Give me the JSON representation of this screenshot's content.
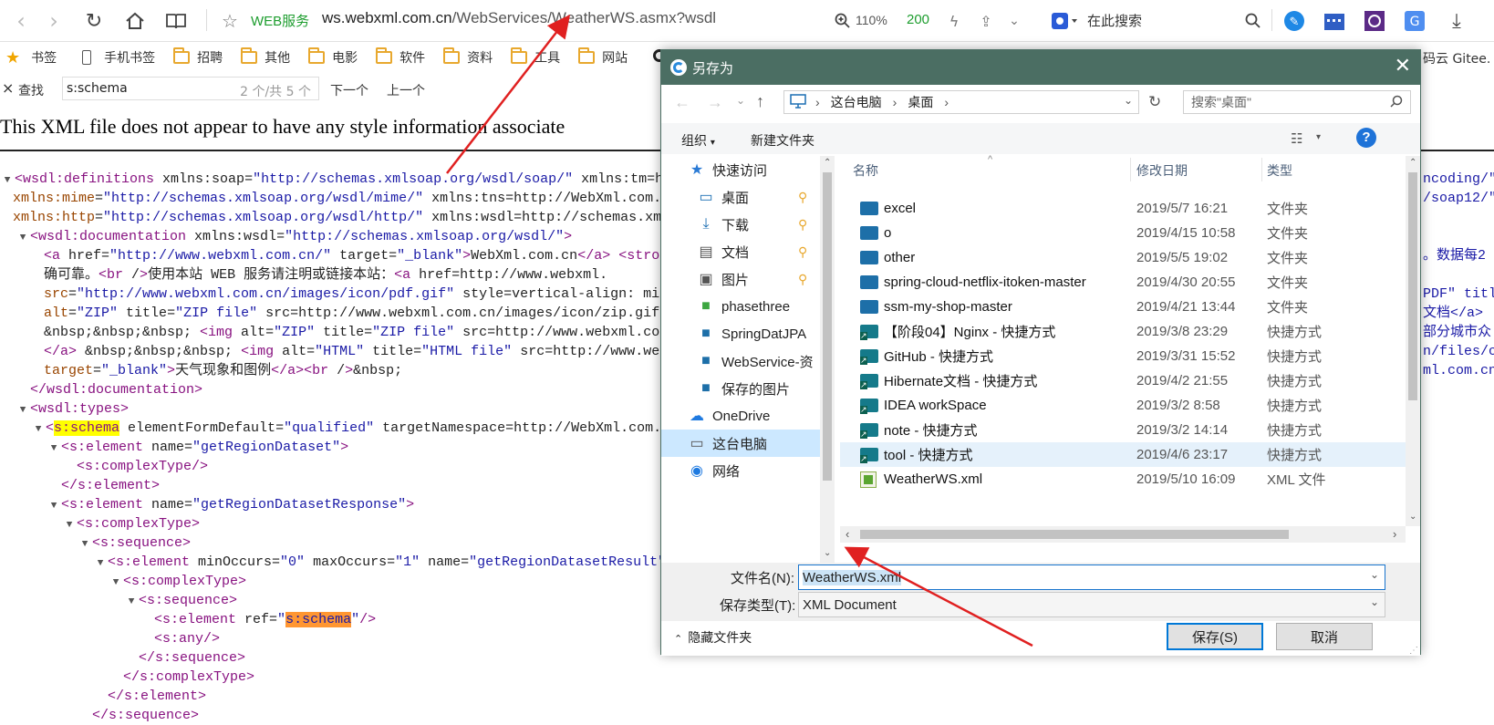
{
  "browser": {
    "service_label": "WEB服务",
    "url_host": "ws.webxml.com.cn",
    "url_path": "/WebServices/WeatherWS.asmx?wsdl",
    "zoom": "110%",
    "hits": "200",
    "search_placeholder": "在此搜索",
    "bookmarks": [
      "书签",
      "手机书签",
      "招聘",
      "其他",
      "电影",
      "软件",
      "资料",
      "工具",
      "网站"
    ],
    "bookmark_right": "码云 Gitee."
  },
  "findbar": {
    "label": "查找",
    "query": "s:schema",
    "count": "2 个/共 5 个",
    "next": "下一个",
    "prev": "上一个"
  },
  "xml_notice": "This XML file does not appear to have any style information associate",
  "xml_lines": [
    "<wsdl:definitions xmlns:soap=\"http://schemas.xmlsoap.org/wsdl/soap/\" xmlns:tm=\"h",
    "xmlns:mime=\"http://schemas.xmlsoap.org/wsdl/mime/\" xmlns:tns=\"http://WebXml.com.",
    "xmlns:http=\"http://schemas.xmlsoap.org/wsdl/http/\" xmlns:wsdl=\"http://schemas.xm",
    "<wsdl:documentation xmlns:wsdl=\"http://schemas.xmlsoap.org/wsdl/\">",
    "<a href=\"http://www.webxml.com.cn/\" target=\"_blank\">WebXml.com.cn</a> <stron",
    "确可靠。<br />使用本站 WEB 服务请注明或链接本站：<a href=\"http://www.webxml.",
    "src=\"http://www.webxml.com.cn/images/icon/pdf.gif\" style=\"vertical-align: mi",
    "alt=\"ZIP\" title=\"ZIP file\" src=\"http://www.webxml.com.cn/images/icon/zip.gif",
    "&nbsp;&nbsp;&nbsp; <img alt=\"ZIP\" title=\"ZIP file\" src=\"http://www.webxml.co",
    "</a> &nbsp;&nbsp;&nbsp; <img alt=\"HTML\" title=\"HTML file\" src=\"http://www.we",
    "target=\"_blank\">天气现象和图例</a><br />&nbsp;",
    "</wsdl:documentation>",
    "<wsdl:types>",
    "<s:schema elementFormDefault=\"qualified\" targetNamespace=\"http://WebXml.com.",
    "<s:element name=\"getRegionDataset\">",
    "<s:complexType/>",
    "</s:element>",
    "<s:element name=\"getRegionDatasetResponse\">",
    "<s:complexType>",
    "<s:sequence>",
    "<s:element minOccurs=\"0\" maxOccurs=\"1\" name=\"getRegionDatasetResult\"",
    "<s:complexType>",
    "<s:sequence>",
    "<s:element ref=\"s:schema\"/>",
    "<s:any/>",
    "</s:sequence>",
    "</s:complexType>",
    "</s:element>",
    "</s:sequence>"
  ],
  "xml_right_fragments": [
    "ncoding/\"",
    "/soap12/\"",
    "。数据每2",
    "PDF\" titl",
    "文档</a>",
    "部分城市众",
    "n/files/c",
    "ml.com.cn"
  ],
  "dialog": {
    "title": "另存为",
    "breadcrumb": [
      "这台电脑",
      "桌面"
    ],
    "search_placeholder": "搜索\"桌面\"",
    "organize": "组织",
    "new_folder": "新建文件夹",
    "nav": [
      {
        "label": "快速访问",
        "icon": "star-icon"
      },
      {
        "label": "桌面",
        "icon": "desktop-icon"
      },
      {
        "label": "下载",
        "icon": "download-icon"
      },
      {
        "label": "文档",
        "icon": "document-icon"
      },
      {
        "label": "图片",
        "icon": "picture-icon"
      },
      {
        "label": "phasethree",
        "icon": "folder-green-icon"
      },
      {
        "label": "SpringDatJPA",
        "icon": "folder-icon"
      },
      {
        "label": "WebService-资",
        "icon": "folder-icon"
      },
      {
        "label": "保存的图片",
        "icon": "folder-icon"
      },
      {
        "label": "OneDrive",
        "icon": "cloud-icon"
      },
      {
        "label": "这台电脑",
        "icon": "computer-icon"
      },
      {
        "label": "网络",
        "icon": "network-icon"
      }
    ],
    "columns": [
      "名称",
      "修改日期",
      "类型"
    ],
    "files": [
      {
        "name": "excel",
        "date": "2019/5/7 16:21",
        "type": "文件夹",
        "kind": "folder"
      },
      {
        "name": "o",
        "date": "2019/4/15 10:58",
        "type": "文件夹",
        "kind": "folder"
      },
      {
        "name": "other",
        "date": "2019/5/5 19:02",
        "type": "文件夹",
        "kind": "folder"
      },
      {
        "name": "spring-cloud-netflix-itoken-master",
        "date": "2019/4/30 20:55",
        "type": "文件夹",
        "kind": "folder"
      },
      {
        "name": "ssm-my-shop-master",
        "date": "2019/4/21 13:44",
        "type": "文件夹",
        "kind": "folder"
      },
      {
        "name": "【阶段04】Nginx - 快捷方式",
        "date": "2019/3/8 23:29",
        "type": "快捷方式",
        "kind": "shortcut"
      },
      {
        "name": "GitHub - 快捷方式",
        "date": "2019/3/31 15:52",
        "type": "快捷方式",
        "kind": "shortcut"
      },
      {
        "name": "Hibernate文档 - 快捷方式",
        "date": "2019/4/2 21:55",
        "type": "快捷方式",
        "kind": "shortcut"
      },
      {
        "name": "IDEA workSpace",
        "date": "2019/3/2 8:58",
        "type": "快捷方式",
        "kind": "shortcut"
      },
      {
        "name": "note - 快捷方式",
        "date": "2019/3/2 14:14",
        "type": "快捷方式",
        "kind": "shortcut"
      },
      {
        "name": "tool - 快捷方式",
        "date": "2019/4/6 23:17",
        "type": "快捷方式",
        "kind": "shortcut"
      },
      {
        "name": "WeatherWS.xml",
        "date": "2019/5/10 16:09",
        "type": "XML 文件",
        "kind": "xml"
      }
    ],
    "filename_label": "文件名(N):",
    "filename_value": "WeatherWS.xml",
    "filetype_label": "保存类型(T):",
    "filetype_value": "XML Document",
    "hide_folders": "隐藏文件夹",
    "save": "保存(S)",
    "cancel": "取消"
  },
  "colors": {
    "dialog_title_bg": "#4b6e63",
    "annotation_arrow": "#e02020",
    "highlight_yellow": "#ffff00",
    "highlight_orange": "#ff9632"
  }
}
